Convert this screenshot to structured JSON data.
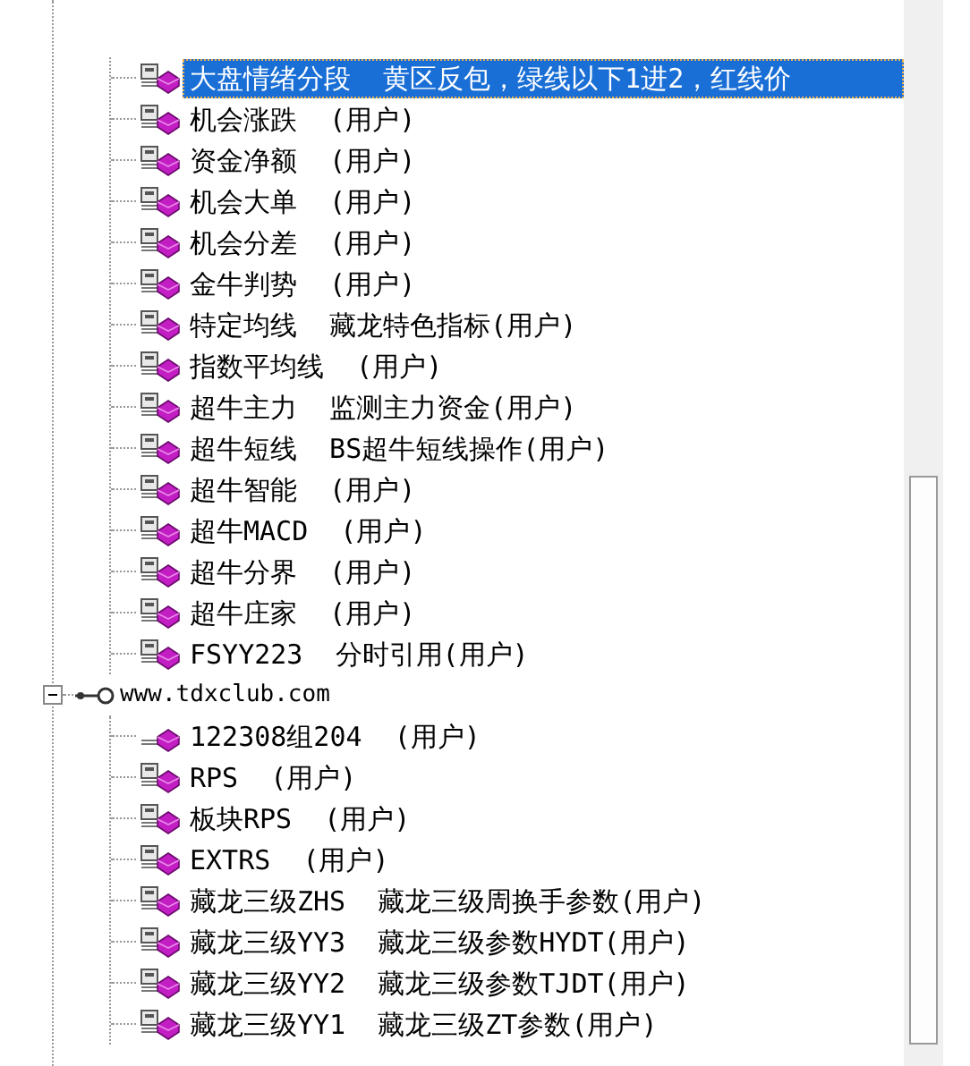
{
  "tree": {
    "items": [
      {
        "label": "大盘情绪分段  黄区反包，绿线以下1进2，红线价",
        "locked": true,
        "selected": true
      },
      {
        "label": "机会涨跌  (用户)",
        "locked": true,
        "selected": false
      },
      {
        "label": "资金净额  (用户)",
        "locked": true,
        "selected": false
      },
      {
        "label": "机会大单  (用户)",
        "locked": true,
        "selected": false
      },
      {
        "label": "机会分差  (用户)",
        "locked": true,
        "selected": false
      },
      {
        "label": "金牛判势  (用户)",
        "locked": true,
        "selected": false
      },
      {
        "label": "特定均线  藏龙特色指标(用户)",
        "locked": true,
        "selected": false
      },
      {
        "label": "指数平均线  (用户)",
        "locked": true,
        "selected": false
      },
      {
        "label": "超牛主力  监测主力资金(用户)",
        "locked": true,
        "selected": false
      },
      {
        "label": "超牛短线  BS超牛短线操作(用户)",
        "locked": true,
        "selected": false
      },
      {
        "label": "超牛智能  (用户)",
        "locked": true,
        "selected": false
      },
      {
        "label": "超牛MACD  (用户)",
        "locked": true,
        "selected": false
      },
      {
        "label": "超牛分界  (用户)",
        "locked": true,
        "selected": false
      },
      {
        "label": "超牛庄家  (用户)",
        "locked": true,
        "selected": false
      },
      {
        "label": "FSYY223  分时引用(用户)",
        "locked": true,
        "selected": false
      }
    ],
    "groups": [
      {
        "label": "www.tdxclub.com",
        "expanded": true,
        "children": [
          {
            "label": "122308组204  (用户)",
            "locked": false,
            "selected": false
          },
          {
            "label": "RPS  (用户)",
            "locked": true,
            "selected": false
          },
          {
            "label": "板块RPS  (用户)",
            "locked": true,
            "selected": false
          },
          {
            "label": "EXTRS  (用户)",
            "locked": true,
            "selected": false
          },
          {
            "label": "藏龙三级ZHS  藏龙三级周换手参数(用户)",
            "locked": true,
            "selected": false
          },
          {
            "label": "藏龙三级YY3  藏龙三级参数HYDT(用户)",
            "locked": true,
            "selected": false
          },
          {
            "label": "藏龙三级YY2  藏龙三级参数TJDT(用户)",
            "locked": true,
            "selected": false
          },
          {
            "label": "藏龙三级YY1  藏龙三级ZT参数(用户)",
            "locked": true,
            "selected": false
          }
        ]
      }
    ]
  }
}
